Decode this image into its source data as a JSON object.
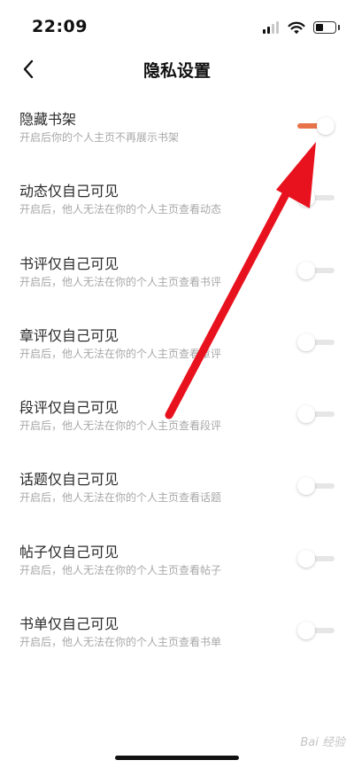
{
  "status_bar": {
    "time": "22:09"
  },
  "nav": {
    "title": "隐私设置"
  },
  "colors": {
    "accent": "#e8734a",
    "arrow": "#e8121e"
  },
  "settings": [
    {
      "title": "隐藏书架",
      "desc": "开启后你的个人主页不再展示书架",
      "enabled": true
    },
    {
      "title": "动态仅自己可见",
      "desc": "开启后，他人无法在你的个人主页查看动态",
      "enabled": false
    },
    {
      "title": "书评仅自己可见",
      "desc": "开启后，他人无法在你的个人主页查看书评",
      "enabled": false
    },
    {
      "title": "章评仅自己可见",
      "desc": "开启后，他人无法在你的个人主页查看章评",
      "enabled": false
    },
    {
      "title": "段评仅自己可见",
      "desc": "开启后，他人无法在你的个人主页查看段评",
      "enabled": false
    },
    {
      "title": "话题仅自己可见",
      "desc": "开启后，他人无法在你的个人主页查看话题",
      "enabled": false
    },
    {
      "title": "帖子仅自己可见",
      "desc": "开启后，他人无法在你的个人主页查看帖子",
      "enabled": false
    },
    {
      "title": "书单仅自己可见",
      "desc": "开启后，他人无法在你的个人主页查看书单",
      "enabled": false
    }
  ],
  "watermark": "Bai 经验"
}
